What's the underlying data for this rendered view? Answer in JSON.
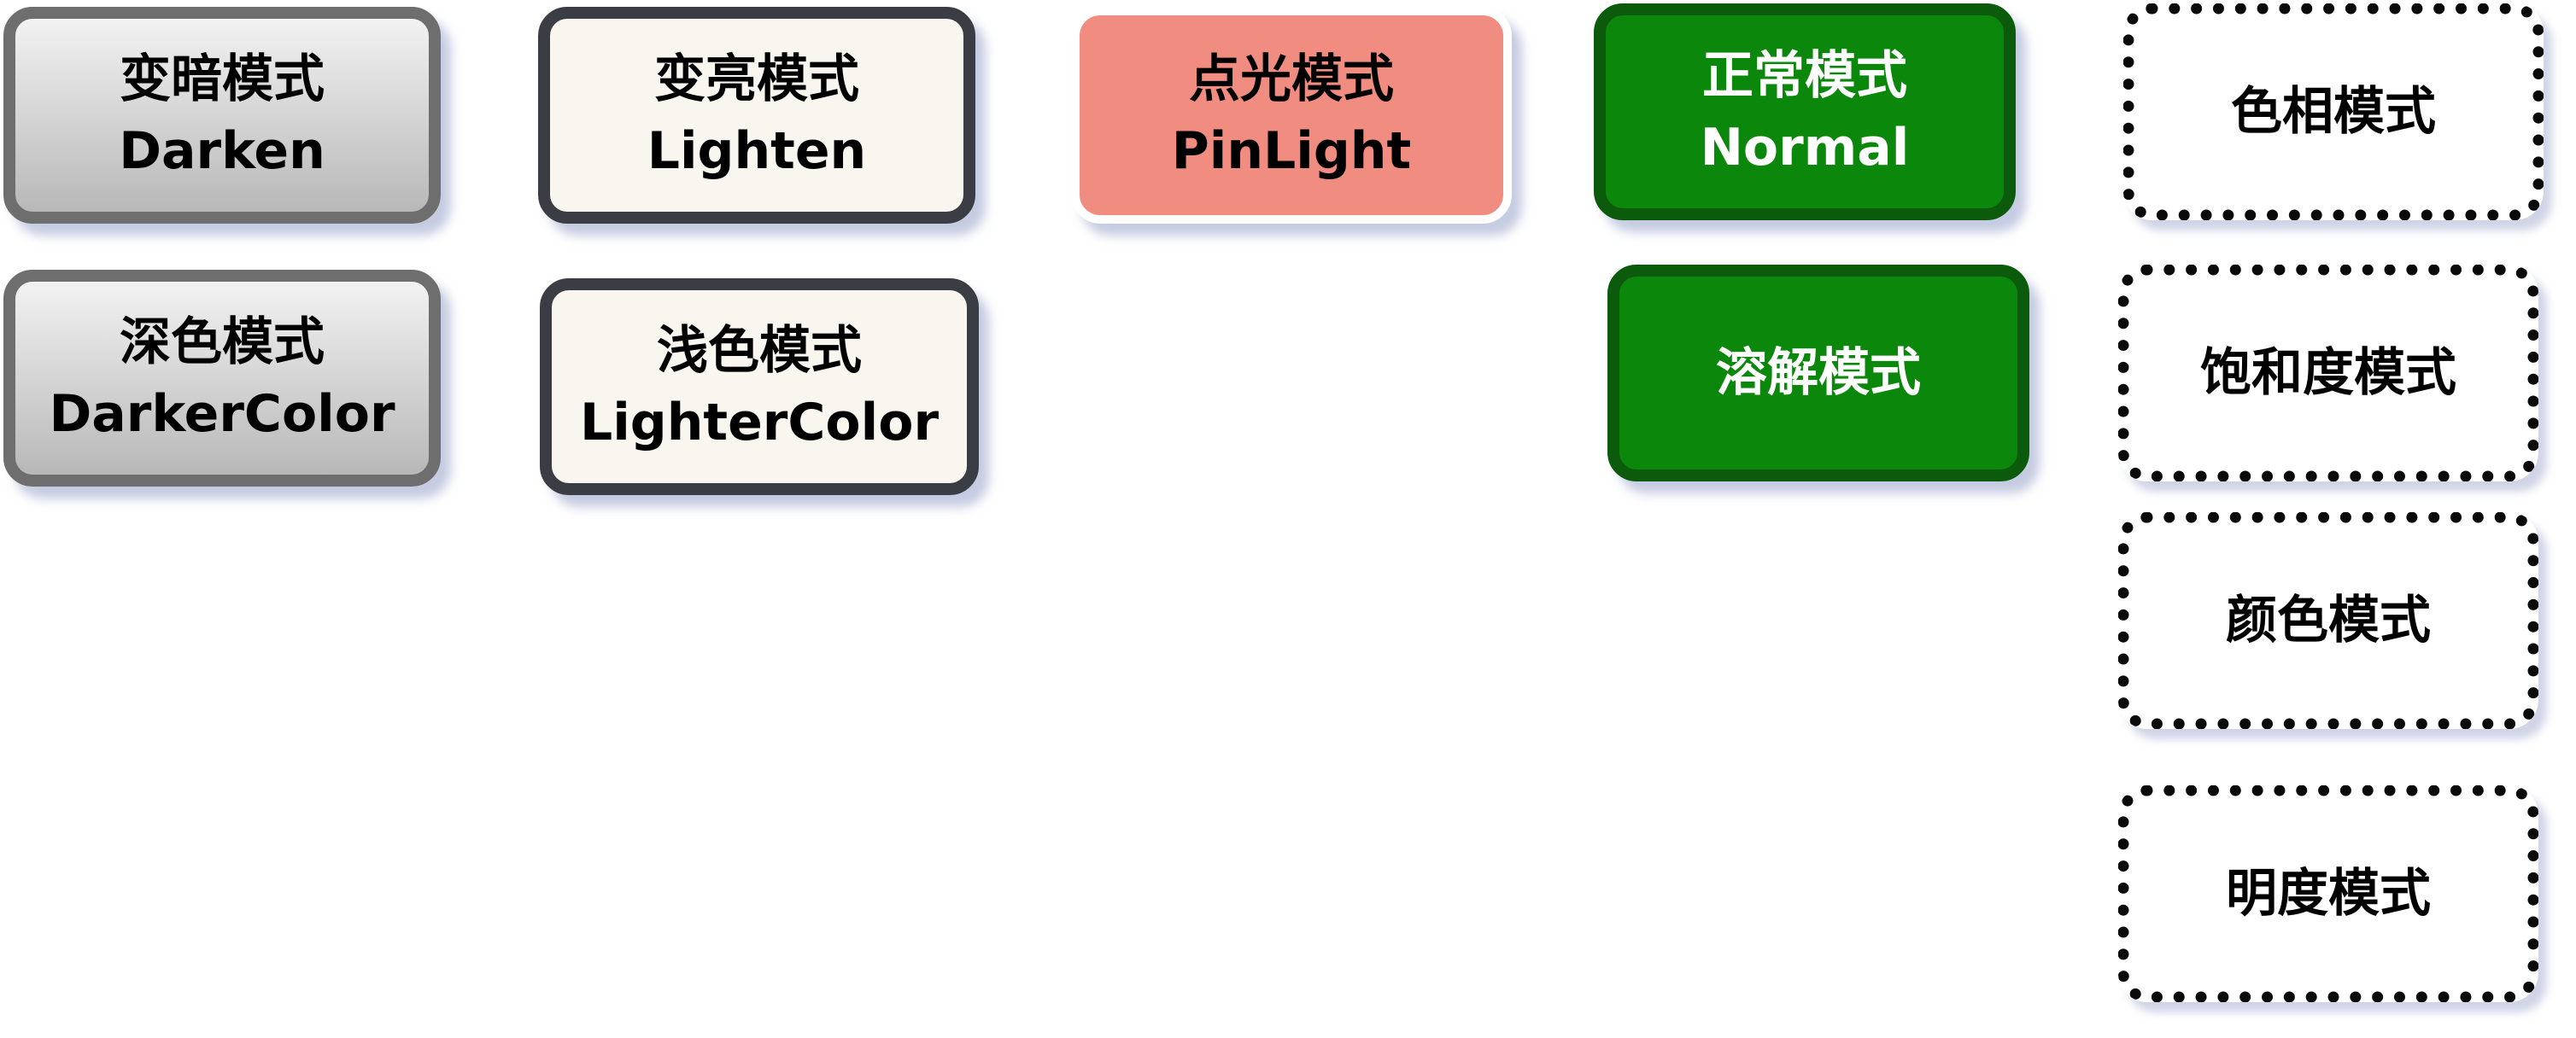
{
  "blend_modes": {
    "darken": {
      "zh": "变暗模式",
      "en": "Darken"
    },
    "darker_color": {
      "zh": "深色模式",
      "en": "DarkerColor"
    },
    "lighten": {
      "zh": "变亮模式",
      "en": "Lighten"
    },
    "lighter_color": {
      "zh": "浅色模式",
      "en": "LighterColor"
    },
    "pin_light": {
      "zh": "点光模式",
      "en": "PinLight"
    },
    "normal": {
      "zh": "正常模式",
      "en": "Normal"
    },
    "dissolve": {
      "zh": "溶解模式"
    },
    "hue": {
      "zh": "色相模式"
    },
    "saturation": {
      "zh": "饱和度模式"
    },
    "color": {
      "zh": "颜色模式"
    },
    "luminosity": {
      "zh": "明度模式"
    }
  },
  "colors": {
    "dark_group_border": "#6e6e6e",
    "light_group_border": "#3a3d44",
    "light_group_fill": "#f8f6ef",
    "pin_light_fill": "#f08c80",
    "normal_group_fill": "#0b880b",
    "normal_group_border": "#0c5a0c",
    "hsl_group_border": "#0a0a0a"
  }
}
